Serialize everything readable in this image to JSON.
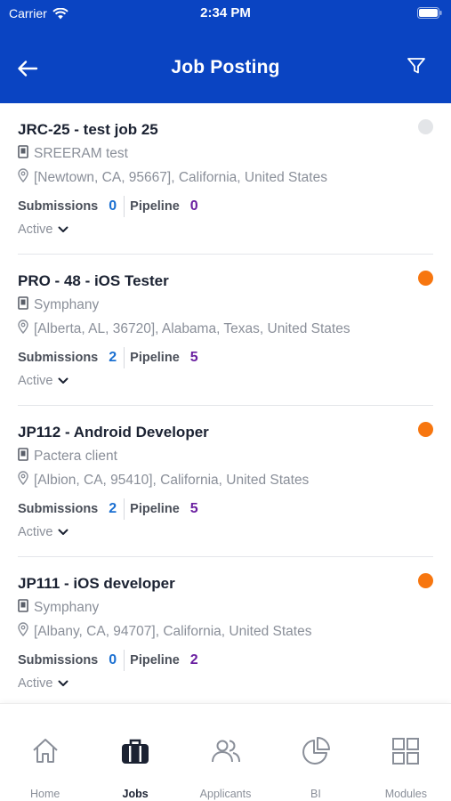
{
  "status_bar": {
    "carrier": "Carrier",
    "time": "2:34 PM"
  },
  "header": {
    "title": "Job Posting",
    "back_icon": "arrow-left-icon",
    "filter_icon": "filter-icon"
  },
  "colors": {
    "header_bg": "#0a44c2",
    "submissions": "#1a6fd1",
    "pipeline": "#6a1fa0",
    "dot_inactive": "#e3e5e8",
    "dot_active": "#f7760f"
  },
  "jobs": [
    {
      "title": "JRC-25 - test job 25",
      "client": "SREERAM test",
      "location": "[Newtown, CA, 95667], California, United States",
      "submissions_label": "Submissions",
      "submissions": "0",
      "pipeline_label": "Pipeline",
      "pipeline": "0",
      "status": "Active",
      "dot_color": "#e3e5e8"
    },
    {
      "title": "PRO - 48 - iOS Tester",
      "client": "Symphany",
      "location": "[Alberta, AL, 36720], Alabama, Texas, United States",
      "submissions_label": "Submissions",
      "submissions": "2",
      "pipeline_label": "Pipeline",
      "pipeline": "5",
      "status": "Active",
      "dot_color": "#f7760f"
    },
    {
      "title": "JP112 - Android Developer",
      "client": "Pactera client",
      "location": "[Albion, CA, 95410], California, United States",
      "submissions_label": "Submissions",
      "submissions": "2",
      "pipeline_label": "Pipeline",
      "pipeline": "5",
      "status": "Active",
      "dot_color": "#f7760f"
    },
    {
      "title": "JP111 - iOS developer",
      "client": "Symphany",
      "location": "[Albany, CA, 94707], California, United States",
      "submissions_label": "Submissions",
      "submissions": "0",
      "pipeline_label": "Pipeline",
      "pipeline": "2",
      "status": "Active",
      "dot_color": "#f7760f"
    }
  ],
  "tabs": [
    {
      "label": "Home",
      "icon": "home-icon",
      "active": false
    },
    {
      "label": "Jobs",
      "icon": "briefcase-icon",
      "active": true
    },
    {
      "label": "Applicants",
      "icon": "users-icon",
      "active": false
    },
    {
      "label": "BI",
      "icon": "pie-chart-icon",
      "active": false
    },
    {
      "label": "Modules",
      "icon": "grid-icon",
      "active": false
    }
  ]
}
